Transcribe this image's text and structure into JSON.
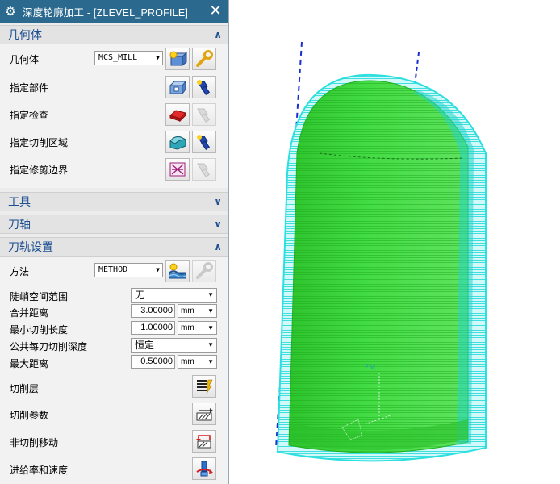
{
  "dialog": {
    "title": "深度轮廓加工 - [ZLEVEL_PROFILE]",
    "close_symbol": "✕"
  },
  "geometry": {
    "header": "几何体",
    "geometry_label": "几何体",
    "geometry_value": "MCS_MILL",
    "specify_part": "指定部件",
    "specify_check": "指定检查",
    "specify_cut_area": "指定切削区域",
    "specify_trim": "指定修剪边界"
  },
  "tool": {
    "header": "工具"
  },
  "axis": {
    "header": "刀轴"
  },
  "path": {
    "header": "刀轨设置",
    "method_label": "方法",
    "method_value": "METHOD",
    "steep_label": "陡峭空间范围",
    "steep_value": "无",
    "merge_label": "合并距离",
    "merge_value": "3.00000",
    "merge_unit": "mm",
    "min_cut_label": "最小切削长度",
    "min_cut_value": "1.00000",
    "min_cut_unit": "mm",
    "depth_label": "公共每刀切削深度",
    "depth_value": "恒定",
    "max_dist_label": "最大距离",
    "max_dist_value": "0.50000",
    "max_dist_unit": "mm",
    "cut_levels": "切削层",
    "cut_params": "切削参数",
    "non_cut": "非切削移动",
    "feeds": "进给率和速度"
  },
  "viewport": {
    "axis_label": "ZM"
  },
  "colors": {
    "title_bar": "#2b6a8e",
    "section_header_text": "#1d4f91",
    "toolpath_cyan": "#3ee6e6",
    "part_green": "#3fd63f",
    "tool_axis_blue": "#1a2fd0"
  }
}
